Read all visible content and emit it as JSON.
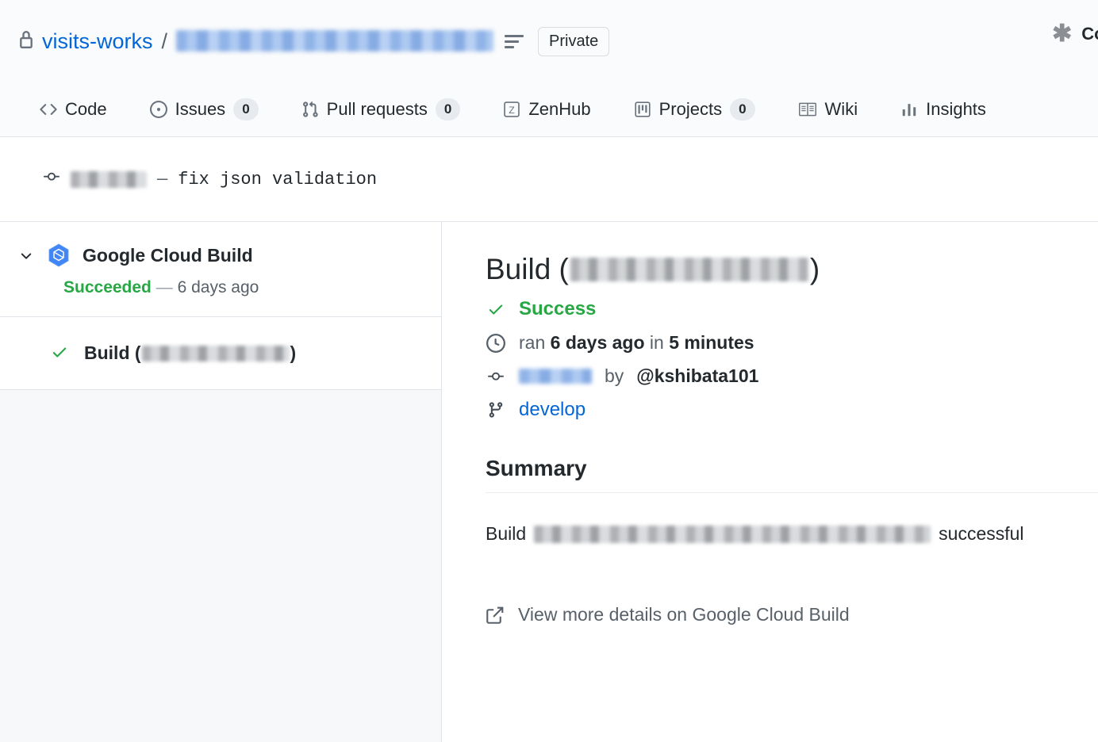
{
  "header": {
    "lock_icon": "lock-icon",
    "owner": "visits-works",
    "separator": "/",
    "repo_name_redacted": "",
    "align_icon": "align-left-icon",
    "visibility_badge": "Private",
    "right_action_icon": "asterisk-icon",
    "right_action_label": "Con"
  },
  "tabs": [
    {
      "label": "Code",
      "icon": "code-icon",
      "count": null
    },
    {
      "label": "Issues",
      "icon": "issue-opened-icon",
      "count": "0"
    },
    {
      "label": "Pull requests",
      "icon": "git-pull-request-icon",
      "count": "0"
    },
    {
      "label": "ZenHub",
      "icon": "zenhub-icon",
      "count": null
    },
    {
      "label": "Projects",
      "icon": "project-icon",
      "count": "0"
    },
    {
      "label": "Wiki",
      "icon": "book-icon",
      "count": null
    },
    {
      "label": "Insights",
      "icon": "graph-icon",
      "count": null
    }
  ],
  "commit_bar": {
    "icon": "commit-icon",
    "sha_redacted": "",
    "dash": "—",
    "message": "fix json validation"
  },
  "sidebar": {
    "check_group": {
      "chevron_icon": "chevron-down-icon",
      "app_icon": "google-cloud-build-icon",
      "name": "Google Cloud Build",
      "status": "Succeeded",
      "dash": "—",
      "time": "6 days ago"
    },
    "check_item": {
      "status_icon": "check-icon",
      "prefix": "Build (",
      "name_redacted": "",
      "suffix": ")"
    }
  },
  "detail": {
    "title_prefix": "Build (",
    "title_redacted": "",
    "title_suffix": ")",
    "status": {
      "icon": "check-icon",
      "label": "Success"
    },
    "timing": {
      "icon": "clock-icon",
      "ran_label": "ran",
      "ran_value": "6 days ago",
      "in_label": "in",
      "duration": "5 minutes"
    },
    "commit": {
      "icon": "commit-icon",
      "sha_redacted": "",
      "by_label": "by",
      "author": "@kshibata101"
    },
    "branch": {
      "icon": "git-branch-icon",
      "name": "develop"
    },
    "summary_heading": "Summary",
    "summary": {
      "prefix": "Build",
      "redacted": "",
      "suffix": "successful"
    },
    "details_link": {
      "icon": "external-link-icon",
      "label": "View more details on Google Cloud Build"
    }
  },
  "colors": {
    "accent_blue": "#0366d6",
    "success_green": "#28a745",
    "muted_gray": "#586069",
    "border": "#e1e4e8",
    "header_bg": "#fafbfc",
    "sidebar_bg": "#f6f8fa"
  }
}
